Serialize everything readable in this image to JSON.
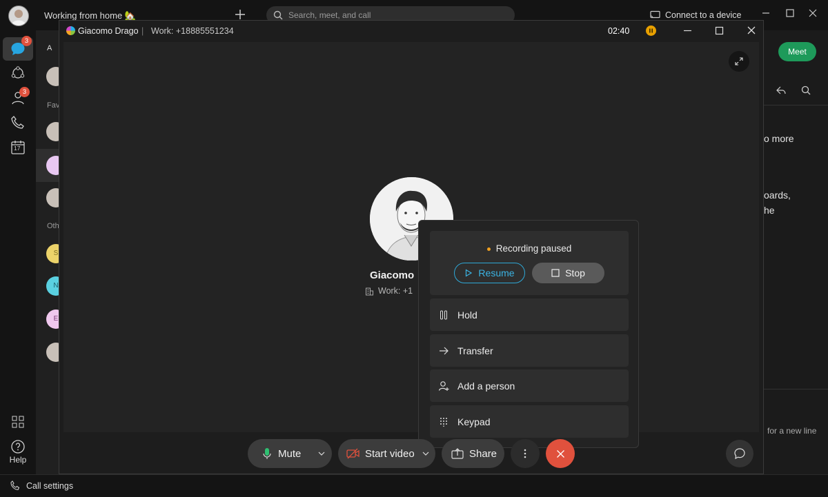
{
  "app": {
    "status_text": "Working from home 🏡",
    "search_placeholder": "Search, meet, and call",
    "connect_device": "Connect to a device",
    "rail": {
      "messaging_badge": "3",
      "contacts_badge": "3",
      "calendar_day": "17",
      "help_label": "Help"
    },
    "list_labels": [
      "A",
      "Fav",
      "Oth"
    ],
    "list_avatar_letters": [
      "S",
      "N",
      "E"
    ],
    "meet_button": "Meet",
    "right_texts": [
      "o more",
      "oards,",
      "he",
      "for a new line"
    ],
    "call_settings": "Call settings"
  },
  "call": {
    "caller_name": "Giacomo Drago",
    "separator": "|",
    "work_number": "Work: +18885551234",
    "timer": "02:40",
    "remote_name": "Giacomo",
    "remote_work": "Work: +1",
    "controls": {
      "mute": "Mute",
      "start_video": "Start video",
      "share": "Share"
    },
    "menu": {
      "recording_status": "Recording paused",
      "resume": "Resume",
      "stop": "Stop",
      "items": [
        "Hold",
        "Transfer",
        "Add a person",
        "Keypad"
      ]
    }
  },
  "colors": {
    "accent_blue": "#2ea9d8",
    "end_call_red": "#e0513d",
    "meet_green": "#1e9a5a",
    "recording_orange": "#f0a020",
    "badge_red": "#e0513d"
  }
}
